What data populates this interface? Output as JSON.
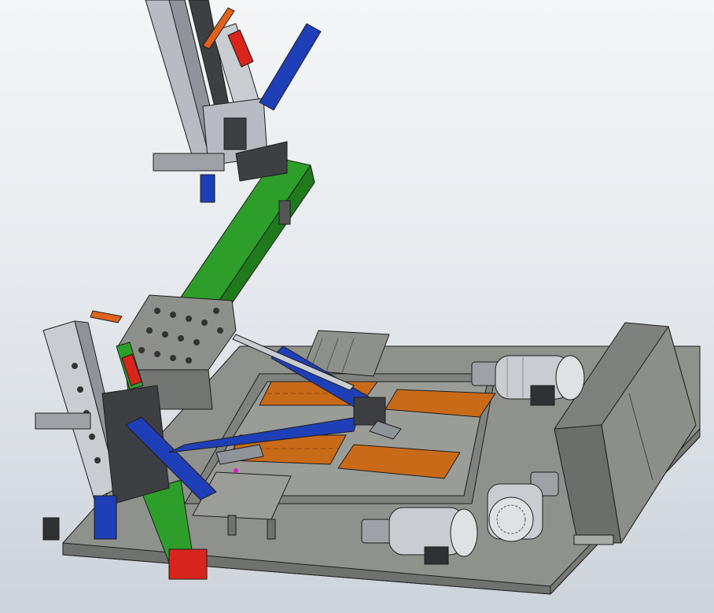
{
  "viewport": {
    "background_top": "#f4f6f8",
    "background_bottom": "#cdd3da"
  },
  "model": {
    "colors": {
      "base_plate": "#8f918d",
      "base_plate_shadow": "#6f726e",
      "gantry_beam": "#2e9e2a",
      "cylinder": "#1f3fb8",
      "electrode_pad": "#c96a18",
      "motor_housing": "#c9ccd0",
      "steel_frame": "#b8bcc2",
      "dark_steel": "#3d3f42",
      "red_cap": "#d9241c",
      "orange_spring": "#e0621c"
    },
    "components": [
      "base-plate",
      "gantry-beam",
      "upper-welding-column",
      "lower-welding-column",
      "clamping-cylinders",
      "electrode-pads",
      "servo-motors",
      "control-cabinet"
    ]
  }
}
